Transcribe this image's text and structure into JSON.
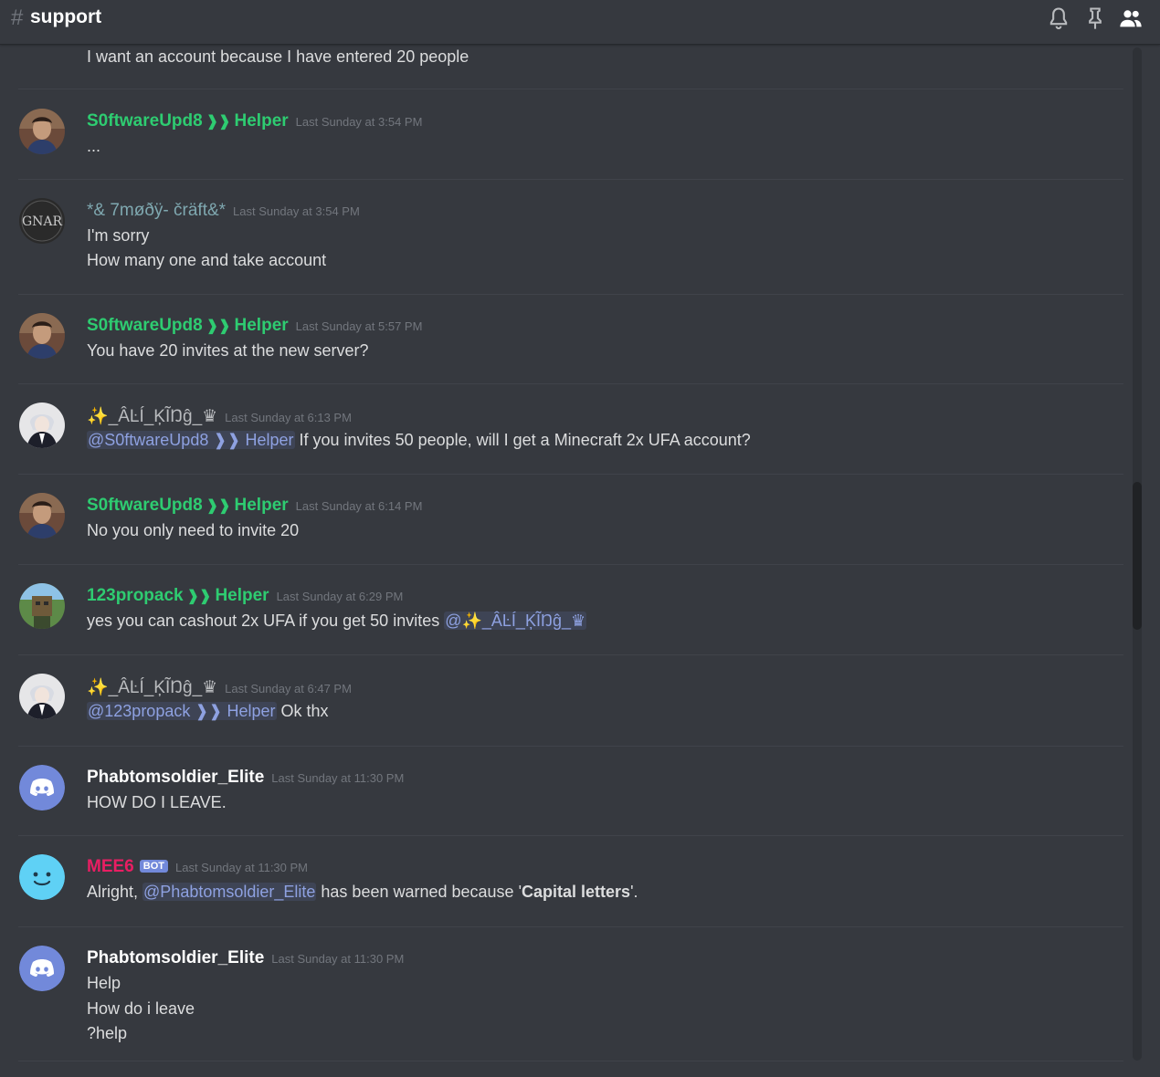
{
  "channel": {
    "hash": "#",
    "name": "support"
  },
  "header_icons": [
    "bell-icon",
    "pin-icon",
    "members-icon"
  ],
  "messages": [
    {
      "lines": [
        "I want an account because I have entered 20 people"
      ]
    },
    {
      "author": "S0ftwareUpd8",
      "role_arrow": "❱❱",
      "role": "Helper",
      "time": "Last Sunday at 3:54 PM",
      "lines": [
        "..."
      ]
    },
    {
      "author": "*& 7møðÿ- čräft&*",
      "time": "Last Sunday at 3:54 PM",
      "avatar_text": "GNAR",
      "lines": [
        "I'm sorry",
        "How many one and take account"
      ]
    },
    {
      "author": "S0ftwareUpd8",
      "role_arrow": "❱❱",
      "role": "Helper",
      "time": "Last Sunday at 5:57 PM",
      "lines": [
        "You have 20 invites at the new server?"
      ]
    },
    {
      "author": "✨_ÂĿÍ_ĶĨŊĝ_♛",
      "time": "Last Sunday at 6:13 PM",
      "mention": "@S0ftwareUpd8 ❱❱ Helper",
      "text_after": " If you invites 50 people, will I get a Minecraft 2x UFA account?"
    },
    {
      "author": "S0ftwareUpd8",
      "role_arrow": "❱❱",
      "role": "Helper",
      "time": "Last Sunday at 6:14 PM",
      "lines": [
        "No you only need to invite 20"
      ]
    },
    {
      "author": "123propack",
      "role_arrow": "❱❱",
      "role": "Helper",
      "time": "Last Sunday at 6:29 PM",
      "text_before": "yes you can cashout 2x UFA if you get 50 invites ",
      "mention": "@✨_ÂĿÍ_ĶĨŊĝ_♛"
    },
    {
      "author": "✨_ÂĿÍ_ĶĨŊĝ_♛",
      "time": "Last Sunday at 6:47 PM",
      "mention": "@123propack ❱❱ Helper",
      "text_after": " Ok thx"
    },
    {
      "author": "Phabtomsoldier_Elite",
      "time": "Last Sunday at 11:30 PM",
      "lines": [
        "HOW DO I LEAVE."
      ]
    },
    {
      "author": "MEE6",
      "bot_tag": "BOT",
      "time": "Last Sunday at 11:30 PM",
      "text_before": "Alright, ",
      "mention": "@Phabtomsoldier_Elite",
      "text_mid": " has been warned because '",
      "bold": "Capital letters",
      "text_after": "'."
    },
    {
      "author": "Phabtomsoldier_Elite",
      "time": "Last Sunday at 11:30 PM",
      "lines": [
        "Help",
        "How do i leave",
        "?help"
      ]
    }
  ],
  "colors": {
    "background": "#36393f",
    "helper_green": "#2ecc71",
    "mention": "#8ea1e1",
    "mee6_red": "#e91e63",
    "blurple": "#7289da"
  }
}
